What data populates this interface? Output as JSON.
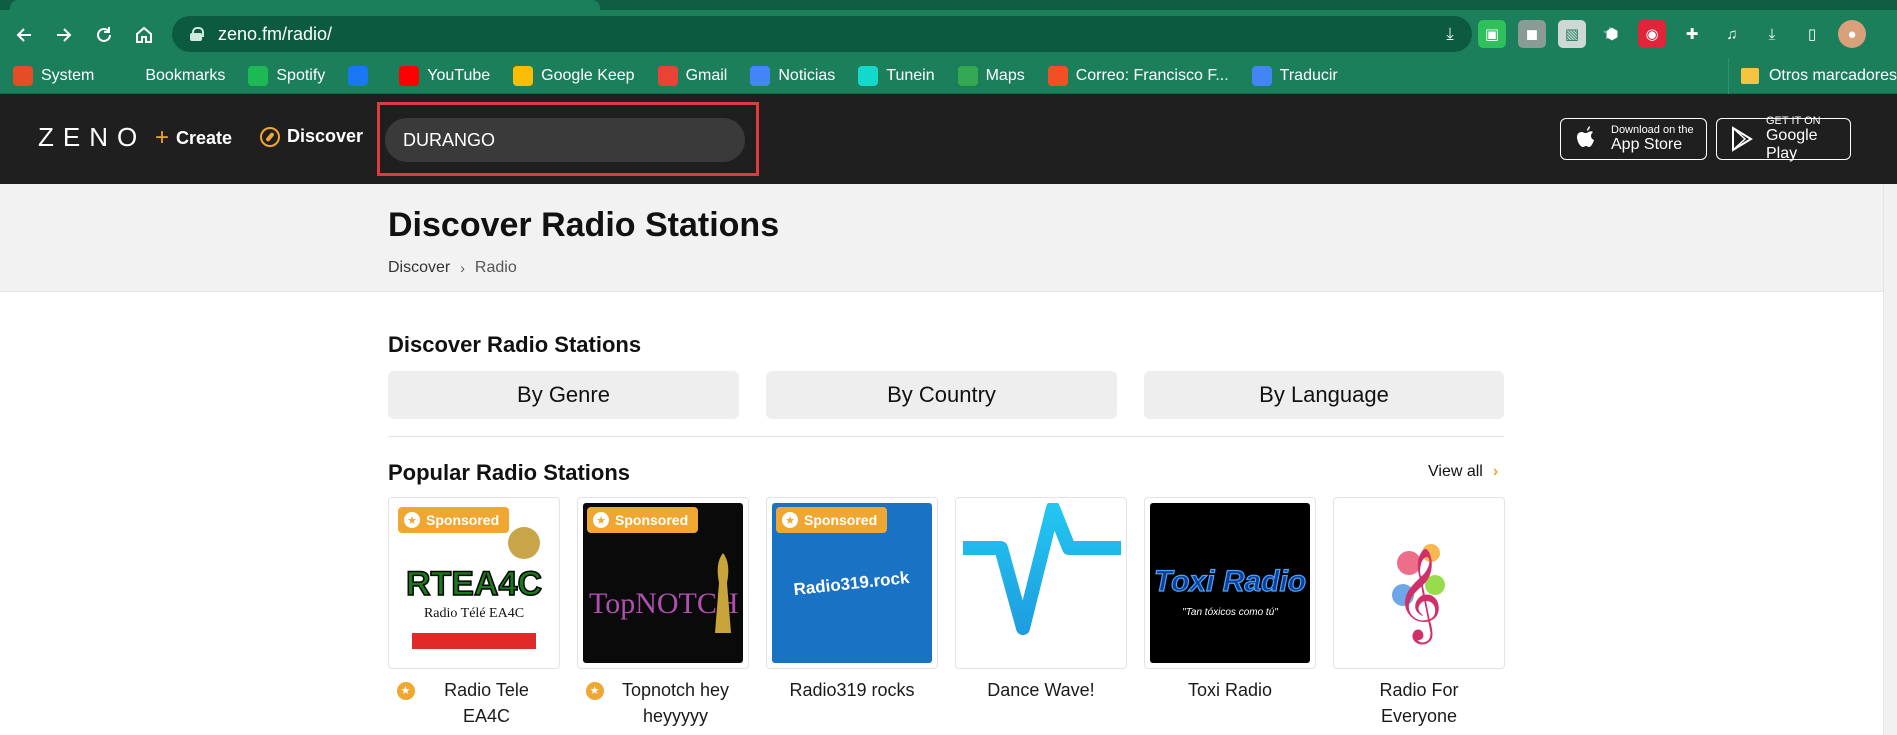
{
  "browser": {
    "url": "zeno.fm/radio/",
    "bookmarks": [
      {
        "label": "System",
        "icon": "joomla-icon",
        "color": "#e44d26"
      },
      {
        "label": "Bookmarks",
        "icon": "star-icon",
        "color": "#1b7f5c"
      },
      {
        "label": "Spotify",
        "icon": "spotify-icon",
        "color": "#1db954"
      },
      {
        "label": "",
        "icon": "facebook-icon",
        "color": "#1877f2"
      },
      {
        "label": "YouTube",
        "icon": "youtube-icon",
        "color": "#ff0000"
      },
      {
        "label": "Google Keep",
        "icon": "google-keep-icon",
        "color": "#fbbc04"
      },
      {
        "label": "Gmail",
        "icon": "gmail-icon",
        "color": "#ea4335"
      },
      {
        "label": "Noticias",
        "icon": "google-news-icon",
        "color": "#4285f4"
      },
      {
        "label": "Tunein",
        "icon": "tunein-icon",
        "color": "#14d8cc"
      },
      {
        "label": "Maps",
        "icon": "google-maps-icon",
        "color": "#34a853"
      },
      {
        "label": "Correo: Francisco F...",
        "icon": "microsoft-icon",
        "color": "#f25022"
      },
      {
        "label": "Traducir",
        "icon": "google-translate-icon",
        "color": "#4285f4"
      }
    ],
    "other_bookmarks": "Otros marcadores"
  },
  "header": {
    "logo": "ZENO",
    "create_label": "Create",
    "discover_label": "Discover",
    "search_value": "DURANGO",
    "app_store": {
      "small": "Download on the",
      "big": "App Store"
    },
    "google_play": {
      "small": "GET IT ON",
      "big": "Google Play"
    },
    "accent_color": "#f0a732",
    "highlight_color": "#e0393e"
  },
  "banner": {
    "title": "Discover Radio Stations",
    "breadcrumb": {
      "parent": "Discover",
      "current": "Radio"
    }
  },
  "main": {
    "section_title": "Discover Radio Stations",
    "filters": [
      "By Genre",
      "By Country",
      "By Language"
    ],
    "popular_title": "Popular Radio Stations",
    "view_all": "View all",
    "sponsored_label": "Sponsored",
    "stations": [
      {
        "name": "Radio Tele EA4C",
        "sponsored": true,
        "art_text": "RTEA4C",
        "art_sub": "Radio Télé EA4C"
      },
      {
        "name": "Topnotch hey heyyyyy",
        "sponsored": true,
        "art_text": "TopNOTCH"
      },
      {
        "name": "Radio319 rocks",
        "sponsored": true,
        "art_text": "Radio319.rock"
      },
      {
        "name": "Dance Wave!",
        "sponsored": false
      },
      {
        "name": "Toxi Radio",
        "sponsored": false,
        "art_text": "Toxi Radio",
        "art_sub": "\"Tan tóxicos como tú\""
      },
      {
        "name": "Radio For Everyone",
        "sponsored": false
      }
    ]
  }
}
